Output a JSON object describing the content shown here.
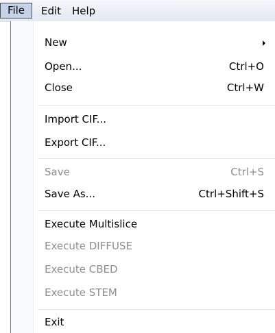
{
  "menubar": {
    "file_label": "File",
    "edit_label": "Edit",
    "help_label": "Help"
  },
  "file_menu": {
    "new": {
      "label": "New"
    },
    "open": {
      "label": "Open...",
      "shortcut": "Ctrl+O"
    },
    "close": {
      "label": "Close",
      "shortcut": "Ctrl+W"
    },
    "import_cif": {
      "label": "Import CIF..."
    },
    "export_cif": {
      "label": "Export CIF..."
    },
    "save": {
      "label": "Save",
      "shortcut": "Ctrl+S",
      "enabled": false
    },
    "save_as": {
      "label": "Save As...",
      "shortcut": "Ctrl+Shift+S"
    },
    "execute_multislice": {
      "label": "Execute Multislice"
    },
    "execute_diffuse": {
      "label": "Execute DIFFUSE",
      "enabled": false
    },
    "execute_cbed": {
      "label": "Execute CBED",
      "enabled": false
    },
    "execute_stem": {
      "label": "Execute STEM",
      "enabled": false
    },
    "exit": {
      "label": "Exit"
    }
  },
  "icons": {
    "submenu": "chevron-right-icon"
  },
  "colors": {
    "active_menu_bg": "#c3d3e8",
    "disabled_text": "#8e8e8e",
    "menubar_bg": "#e8edf4"
  }
}
